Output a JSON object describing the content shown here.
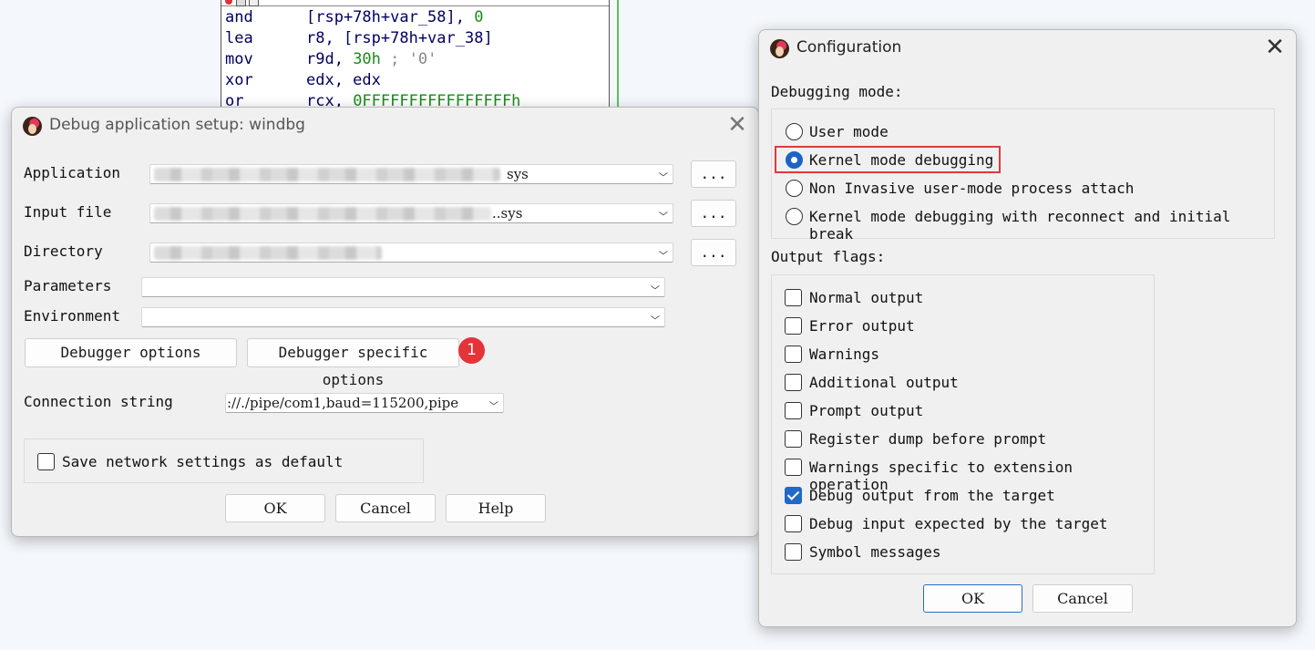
{
  "code_listing": {
    "lines": [
      {
        "mnemonic": "and",
        "operand_a": "[rsp+78h+var_58], ",
        "num": "0",
        "comment": ""
      },
      {
        "mnemonic": "lea",
        "operand_a": "r8, [rsp+78h+var_38]",
        "num": "",
        "comment": ""
      },
      {
        "mnemonic": "mov",
        "operand_a": "r9d, ",
        "num": "30h",
        "comment": " ; '0'"
      },
      {
        "mnemonic": "xor",
        "operand_a": "edx, edx",
        "num": "",
        "comment": ""
      },
      {
        "mnemonic": "or",
        "operand_a": "rcx, ",
        "num": "0FFFFFFFFFFFFFFFFh",
        "comment": ""
      }
    ]
  },
  "debug_setup": {
    "title": "Debug application setup: windbg",
    "application": {
      "label": "Application",
      "value": "sys",
      "browse": "..."
    },
    "input_file": {
      "label": "Input file",
      "value": "..sys",
      "browse": "..."
    },
    "directory": {
      "label": "Directory",
      "value": "",
      "browse": "..."
    },
    "parameters": {
      "label": "Parameters",
      "value": ""
    },
    "environment": {
      "label": "Environment",
      "value": ""
    },
    "debugger_options": "Debugger options",
    "debugger_specific_options": "Debugger specific options",
    "annotation_badge": "1",
    "connection_string": {
      "label": "Connection string",
      "value": "://./pipe/com1,baud=115200,pipe"
    },
    "save_network": {
      "label": "Save network settings as default",
      "checked": false
    },
    "ok": "OK",
    "cancel": "Cancel",
    "help": "Help"
  },
  "configuration": {
    "title": "Configuration",
    "debugging_mode_label": "Debugging mode:",
    "modes": [
      {
        "label": "User mode",
        "selected": false
      },
      {
        "label": "Kernel mode debugging",
        "selected": true
      },
      {
        "label": "Non Invasive user-mode process attach",
        "selected": false
      },
      {
        "label": "Kernel mode debugging with reconnect and initial break",
        "selected": false
      }
    ],
    "output_flags_label": "Output flags:",
    "flags": [
      {
        "label": "Normal output",
        "checked": false
      },
      {
        "label": "Error output",
        "checked": false
      },
      {
        "label": "Warnings",
        "checked": false
      },
      {
        "label": "Additional output",
        "checked": false
      },
      {
        "label": "Prompt output",
        "checked": false
      },
      {
        "label": "Register dump before prompt",
        "checked": false
      },
      {
        "label": "Warnings specific to extension operation",
        "checked": false
      },
      {
        "label": "Debug output from the target",
        "checked": true
      },
      {
        "label": "Debug input expected by the target",
        "checked": false
      },
      {
        "label": "Symbol messages",
        "checked": false
      }
    ],
    "ok": "OK",
    "cancel": "Cancel"
  },
  "colors": {
    "accent": "#2169c8",
    "highlight": "#e03a3a",
    "badge": "#e5333a"
  }
}
